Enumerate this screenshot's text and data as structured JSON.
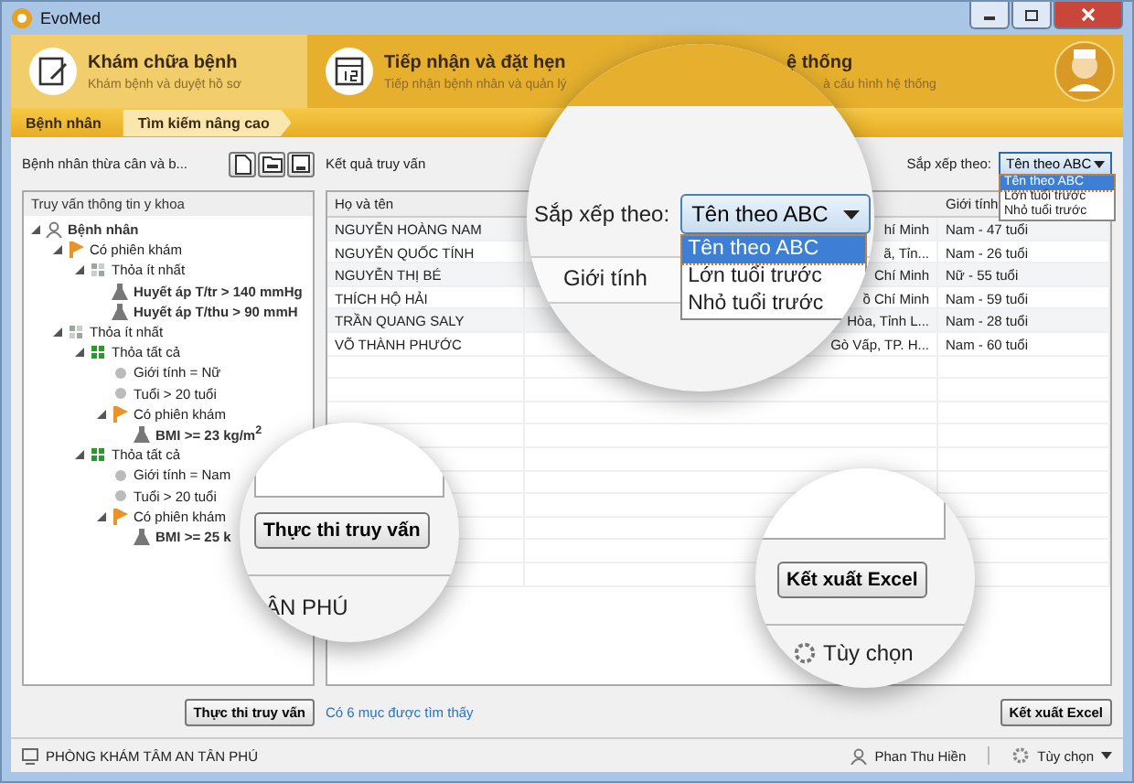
{
  "window": {
    "title": "EvoMed"
  },
  "modules": [
    {
      "title": "Khám chữa bệnh",
      "subtitle": "Khám bệnh và duyệt hồ sơ",
      "kind": "exam",
      "selected": true
    },
    {
      "title": "Tiếp nhận và đặt hẹn",
      "subtitle": "Tiếp nhận bệnh nhân và quản lý",
      "kind": "calendar",
      "selected": false
    },
    {
      "title": "ệ thống",
      "subtitle": "à cấu hình hệ thống",
      "kind": "none",
      "selected": false
    }
  ],
  "breadcrumb": [
    {
      "label": "Bệnh nhân",
      "selected": false
    },
    {
      "label": "Tìm kiếm nâng cao",
      "selected": true
    }
  ],
  "query": {
    "name": "Bệnh nhân thừa cân và b...",
    "tree_title": "Truy vấn thông tin y khoa",
    "tree": [
      {
        "label": "Bệnh nhân",
        "kind": "person",
        "expanded": true,
        "children": [
          {
            "label": "Có phiên khám",
            "kind": "session",
            "expanded": true,
            "children": [
              {
                "label": "Thỏa ít nhất",
                "kind": "any",
                "expanded": true,
                "children": [
                  {
                    "label": "Huyết áp T/tr > 140 mmHg",
                    "kind": "test"
                  },
                  {
                    "label": "Huyết áp T/thu > 90 mmH",
                    "kind": "test"
                  }
                ]
              }
            ]
          },
          {
            "label": "Thỏa ít nhất",
            "kind": "any",
            "expanded": true,
            "children": [
              {
                "label": "Thỏa tất cả",
                "kind": "all",
                "expanded": true,
                "children": [
                  {
                    "label": "Giới tính = Nữ",
                    "kind": "condition"
                  },
                  {
                    "label": "Tuổi > 20 tuổi",
                    "kind": "condition"
                  },
                  {
                    "label": "Có phiên khám",
                    "kind": "session",
                    "expanded": true,
                    "children": [
                      {
                        "label": "BMI >= 23 kg/m$^{2}$",
                        "kind": "test"
                      }
                    ]
                  }
                ]
              },
              {
                "label": "Thỏa tất cả",
                "kind": "all",
                "expanded": true,
                "children": [
                  {
                    "label": "Giới tính = Nam",
                    "kind": "condition"
                  },
                  {
                    "label": "Tuổi > 20 tuổi",
                    "kind": "condition"
                  },
                  {
                    "label": "Có phiên khám",
                    "kind": "session",
                    "expanded": true,
                    "children": [
                      {
                        "label": "BMI >= 25 k",
                        "kind": "test"
                      }
                    ]
                  }
                ]
              }
            ]
          }
        ]
      }
    ],
    "run_button": "Thực thi truy vấn"
  },
  "results": {
    "title": "Kết quả truy vấn",
    "sort_label": "Sắp xếp theo:",
    "sort_value": "Tên theo ABC",
    "sort_expanded": true,
    "sort_options": [
      {
        "label": "Tên theo ABC",
        "selected": true
      },
      {
        "label": "Lớn tuổi trước",
        "selected": false
      },
      {
        "label": "Nhỏ tuổi trước",
        "selected": false
      }
    ],
    "columns": [
      "Họ và tên",
      "Giới tính"
    ],
    "rows": [
      {
        "name": "NGUYỄN HOÀNG NAM",
        "column_2": "hí Minh",
        "gender": "Nam - 47 tuổi"
      },
      {
        "name": "NGUYỄN QUỐC TÍNH",
        "column_2": "ã, Tỉn...",
        "gender": "Nam - 26 tuổi"
      },
      {
        "name": "NGUYỄN THỊ BÉ",
        "column_2": "Chí Minh",
        "gender": "Nữ - 55 tuổi"
      },
      {
        "name": "THÍCH HỘ HẢI",
        "column_2": "ồ Chí Minh",
        "gender": "Nam - 59 tuổi"
      },
      {
        "name": "TRẦN QUANG SALY",
        "column_2": "Hòa, Tỉnh L...",
        "gender": "Nam - 28 tuổi"
      },
      {
        "name": "VÕ THÀNH PHƯỚC",
        "column_2": "Gò Vấp, TP. H...",
        "gender": "Nam - 60 tuổi"
      }
    ],
    "count": "Có 6 mục được tìm thấy",
    "export_button": "Kết xuất Excel"
  },
  "status_bar": {
    "clinic": "PHÒNG KHÁM TÂM AN TÂN PHÚ",
    "user": "Phan Thu Hiền",
    "options": "Tùy chọn"
  },
  "magnifiers": {
    "sort": {
      "label": "Sắp xếp theo:",
      "value": "Tên theo ABC",
      "options": [
        {
          "label": "Tên theo ABC",
          "selected": true
        },
        {
          "label": "Lớn tuổi trước",
          "selected": false
        },
        {
          "label": "Nhỏ tuổi trước",
          "selected": false
        }
      ],
      "column": "Giới tính"
    },
    "run": {
      "button": "Thực thi truy vấn",
      "footer": "ÂN PHÚ"
    },
    "export": {
      "button": "Kết xuất Excel",
      "options": "Tùy chọn"
    }
  }
}
